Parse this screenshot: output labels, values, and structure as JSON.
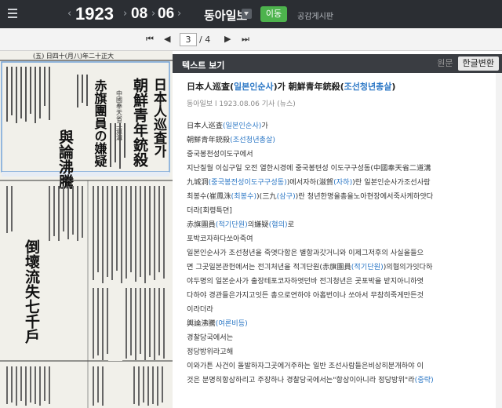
{
  "topbar": {
    "year": "1923",
    "month": "08",
    "day": "06",
    "newspaper": "동아일보",
    "go_label": "이동",
    "board_label": "공감게시판",
    "prev_icon": "chevron-left-icon",
    "next_icon": "chevron-right-icon"
  },
  "pager": {
    "current": "3",
    "total": "/ 4"
  },
  "newspaper_image": {
    "masthead": "(五) 日四十(月八)年二十正大",
    "cols": [
      [
        "日本人巡査가",
        "朝鮮青年銃殺"
      ],
      [
        "中國奉天省二道溝",
        "赤旗團員の嫌疑"
      ],
      [
        "與論沸騰"
      ],
      [
        "倒壞流失七千戶"
      ]
    ]
  },
  "panel": {
    "title": "텍스트 보기",
    "tab_original": "원문",
    "tab_converted": "한글변환",
    "headline_pre": "日本人巡査(",
    "headline_link1": "일본인순사",
    "headline_mid": ")가 朝鮮青年銃殺(",
    "headline_link2": "조선청년총살",
    "headline_post": ")",
    "meta": "동아일보 l 1923.08.06 기사 (뉴스)",
    "lines": [
      "日本人巡査(일본인순사)가",
      "朝鮮青年銃殺(조선청년총살)",
      "중국봉천성이도구에서",
      "지난칠월 이십구일 오전 열한시경에 중국봉텬성 이도구구성동(中國奉天省二道溝",
      "九城洞(중국봉전성이도구구성동))에서자하(滋賀(자하))란 일본인순사가조선사람",
      "최봉수(崔鳳洙(최봉수))(三九(삼구))란 청년한명을총을노아현장에서죽사케하얏다",
      "더라[회령특뎐]",
      "赤旗團員(적기단원)의嫌疑(혐의)로",
      "포박코자하다쏘아죽여",
      "일본인순사가 조선청년을 죽엿다함은 별항과갓거니와 이제그저후의 사실을들으",
      "면 그곳일본관헌에서는 전긔처년을 적긔단원(赤旗團員(적기단원))의혐의가잇다하",
      "야두명의 일본순사가 출장테포코자하엿던바 전긔청년은 곳포박을 받지아니하엿",
      "다하야 경관들은가지고잇든 총으로연하야 아홉번이나 쏘아서 무참히죽게만든것",
      "이라더라",
      "輿論沸騰(여론비등)",
      "경찰당국에서는",
      "정당방위라고해",
      "이와가튼 사건이 돌발하자그곳에거주하는 일반 조선사람들은비상히분개하야 이",
      "것은 분명히항상하리고 주장하나 경찰당국에서는\"항상이아니라 정당방위\"라(중략)"
    ]
  }
}
